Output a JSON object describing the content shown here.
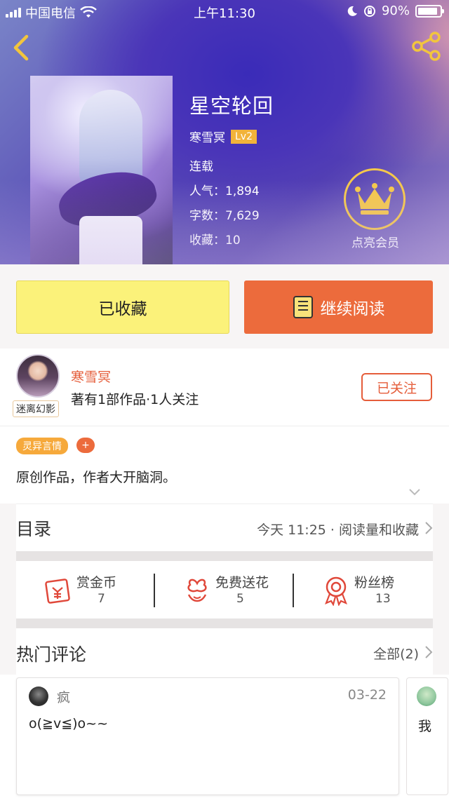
{
  "status_bar": {
    "carrier": "中国电信",
    "time": "上午11:30",
    "battery": "90%",
    "battery_level": 0.9
  },
  "book": {
    "title": "星空轮回",
    "author": "寒雪冥",
    "level": "Lv2",
    "status": "连载",
    "popularity": "人气：1,894",
    "word_count": "字数：7,629",
    "favorites": "收藏：10"
  },
  "member": {
    "label": "点亮会员",
    "icon": "crown-icon"
  },
  "actions": {
    "collected_label": "已收藏",
    "read_label": "继续阅读"
  },
  "author": {
    "name": "寒雪冥",
    "summary": "著有1部作品·1人关注",
    "avatar_tag": "迷离幻影",
    "follow_label": "已关注"
  },
  "tags": {
    "genre": "灵异言情",
    "add": "+"
  },
  "description": "原创作品，作者大开脑洞。",
  "catalog": {
    "title": "目录",
    "meta": "今天 11:25 · 阅读量和收藏"
  },
  "stats": [
    {
      "icon": "red-envelope-icon",
      "label": "赏金币",
      "value": "7"
    },
    {
      "icon": "flower-icon",
      "label": "免费送花",
      "value": "5"
    },
    {
      "icon": "medal-icon",
      "label": "粉丝榜",
      "value": "13"
    }
  ],
  "comments": {
    "title": "热门评论",
    "all_label": "全部(2)",
    "items": [
      {
        "user": "疯",
        "date": "03-22",
        "text": "o(≧v≦)o~~"
      },
      {
        "user": "",
        "date": "",
        "text": "我"
      }
    ]
  },
  "colors": {
    "accent_orange": "#ec6b3c",
    "collected_yellow": "#fbf27a",
    "author_red": "#e55d3a",
    "tag_orange": "#f6a93b",
    "crown_gold": "#f5c84a"
  }
}
